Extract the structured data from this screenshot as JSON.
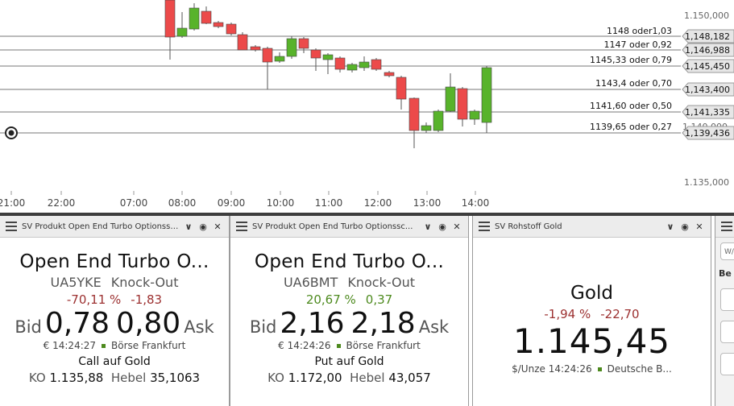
{
  "chart": {
    "time_labels": [
      "21:00",
      "22:00",
      "07:00",
      "08:00",
      "09:00",
      "10:00",
      "11:00",
      "12:00",
      "13:00",
      "14:00"
    ],
    "price_labels": [
      "1.150,000",
      "1.135,000"
    ],
    "levels": [
      {
        "note": "1148 oder1,03",
        "price": "1,148,182"
      },
      {
        "note": "1147 oder 0,92",
        "price": "1,146,988"
      },
      {
        "note": "1145,33 oder 0,79",
        "price": "1,145,450"
      },
      {
        "note": "1143,4 oder 0,70",
        "price": "1,143,400"
      },
      {
        "note": "1141,60 oder 0,50",
        "price": "1,141,335"
      },
      {
        "note": "1139,65 oder 0,27",
        "price": "1,139,436"
      }
    ],
    "colors": {
      "up": "#58b32b",
      "down": "#ec4a4a",
      "line": "#777777",
      "tag": "#e6e6e6"
    }
  },
  "panel1": {
    "title": "SV Produkt Open End Turbo Optionssc...",
    "name": "Open End Turbo O...",
    "wkn": "UA5YKE",
    "type": "Knock-Out",
    "chg_pct": "-70,11 %",
    "chg_abs": "-1,83",
    "bid_label": "Bid",
    "bid": "0,78",
    "ask": "0,80",
    "ask_label": "Ask",
    "time": "€ 14:24:27",
    "exchange": "Börse Frankfurt",
    "underlying": "Call auf Gold",
    "ko_label": "KO",
    "ko": "1.135,88",
    "lev_label": "Hebel",
    "lev": "35,1063"
  },
  "panel2": {
    "title": "SV Produkt Open End Turbo Optionssc...",
    "name": "Open End Turbo O...",
    "wkn": "UA6BMT",
    "type": "Knock-Out",
    "chg_pct": "20,67 %",
    "chg_abs": "0,37",
    "bid_label": "Bid",
    "bid": "2,16",
    "ask": "2,18",
    "ask_label": "Ask",
    "time": "€ 14:24:26",
    "exchange": "Börse Frankfurt",
    "underlying": "Put auf Gold",
    "ko_label": "KO",
    "ko": "1.172,00",
    "lev_label": "Hebel",
    "lev": "43,057"
  },
  "panel3": {
    "title": "SV Rohstoff Gold",
    "name": "Gold",
    "chg_pct": "-1,94 %",
    "chg_abs": "-22,70",
    "price": "1.145,45",
    "time": "$/Unze 14:24:26",
    "exchange": "Deutsche B..."
  },
  "panel4": {
    "input_text": "W/",
    "label": "Be"
  },
  "icons": {
    "menu": "menu-icon",
    "collapse": "chevron-down-icon",
    "target": "target-icon",
    "close": "close-icon"
  }
}
